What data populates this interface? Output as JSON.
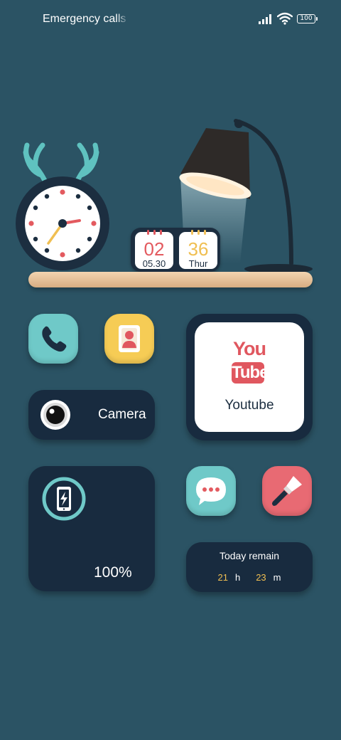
{
  "status_bar": {
    "carrier_text": "Emergency calls o",
    "battery_level": "100",
    "signal_icon": "signal-icon",
    "wifi_icon": "wifi-icon",
    "battery_icon": "battery-icon"
  },
  "scene": {
    "clock": {
      "hour_hand": "3",
      "minute_hand": "39"
    },
    "calendar": {
      "day": "02",
      "date": "05.30",
      "week": "36",
      "weekday": "Thur"
    }
  },
  "apps": {
    "phone": {
      "icon": "phone-icon"
    },
    "contacts": {
      "icon": "contacts-icon"
    },
    "camera": {
      "label": "Camera",
      "icon": "camera-lens-icon"
    },
    "youtube": {
      "logo_you": "You",
      "logo_tube": "Tube",
      "label": "Youtube"
    },
    "messages": {
      "icon": "chat-bubble-icon"
    },
    "themes": {
      "icon": "paint-brush-icon"
    }
  },
  "battery_widget": {
    "percent": "100%",
    "icon": "phone-charging-icon"
  },
  "screen_time": {
    "title": "Today remain",
    "hours": "21",
    "hours_unit": "h",
    "minutes": "23",
    "minutes_unit": "m"
  },
  "colors": {
    "background": "#2b5364",
    "widget_dark": "#182b3f",
    "teal": "#6fc9c8",
    "yellow": "#f6cc55",
    "pink": "#e86a73",
    "accent_red": "#e35a5f",
    "accent_yellow": "#f0bf52"
  }
}
